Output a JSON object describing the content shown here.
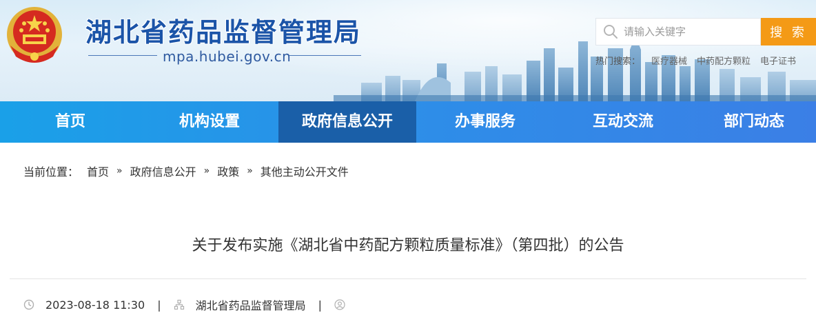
{
  "header": {
    "site_title": "湖北省药品监督管理局",
    "domain": "mpa.hubei.gov.cn",
    "emblem_icon": "national-emblem-icon"
  },
  "search": {
    "placeholder": "请输入关键字",
    "button_label": "搜 索",
    "hot_label": "热门搜索：",
    "hot_items": [
      "医疗器械",
      "中药配方颗粒",
      "电子证书"
    ]
  },
  "nav": {
    "items": [
      "首页",
      "机构设置",
      "政府信息公开",
      "办事服务",
      "互动交流",
      "部门动态"
    ],
    "active": "政府信息公开"
  },
  "breadcrumb": {
    "label": "当前位置：",
    "items": [
      "首页",
      "政府信息公开",
      "政策",
      "其他主动公开文件"
    ],
    "separator": "»"
  },
  "article": {
    "title": "关于发布实施《湖北省中药配方颗粒质量标准》（第四批）的公告",
    "date": "2023-08-18 11:30",
    "source": "湖北省药品监督管理局",
    "meta_separator": "|"
  },
  "colors": {
    "title_blue": "#1b54a8",
    "nav_active": "#1a5fa8",
    "search_button": "#f49a16"
  }
}
